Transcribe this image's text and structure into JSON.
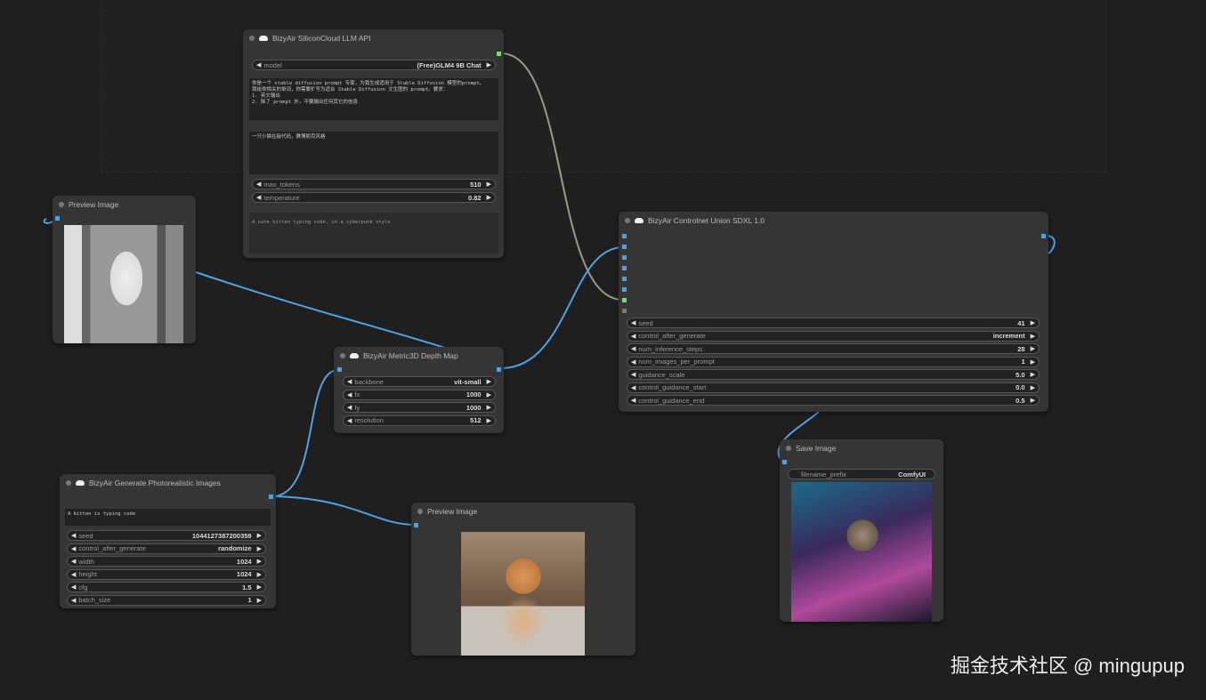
{
  "llm": {
    "title": "BizyAir SiliconCloud LLM API",
    "model_label": "model",
    "model_value": "(Free)GLM4 9B Chat",
    "system_prompt": "你是一个 stable diffusion prompt 专家，为我生成适用于 Stable Diffusion 模型的prompt。\n我给你相关的单词，你需要扩写为适合 Stable Diffusion 文生图的 prompt。要求：\n1. 英文输出\n2. 除了 prompt 外，不要输出任何其它的信息",
    "user_prompt": "一只小猫在敲代码，赛博朋克风格",
    "max_tokens_label": "max_tokens",
    "max_tokens": "510",
    "temperature_label": "temperature",
    "temperature": "0.82",
    "output": "A cute kitten typing code, in a cyberpunk style"
  },
  "preview1": {
    "title": "Preview Image"
  },
  "depth": {
    "title": "BizyAir Metric3D Depth Map",
    "widgets": [
      {
        "label": "backbone",
        "value": "vit-small"
      },
      {
        "label": "fx",
        "value": "1000"
      },
      {
        "label": "fy",
        "value": "1000"
      },
      {
        "label": "resolution",
        "value": "512"
      }
    ]
  },
  "gen": {
    "title": "BizyAir Generate Photorealistic Images",
    "prompt": "A kitten is typing code",
    "widgets": [
      {
        "label": "seed",
        "value": "1044127387200359"
      },
      {
        "label": "control_after_generate",
        "value": "randomize"
      },
      {
        "label": "width",
        "value": "1024"
      },
      {
        "label": "height",
        "value": "1024"
      },
      {
        "label": "cfg",
        "value": "1.5"
      },
      {
        "label": "batch_size",
        "value": "1"
      }
    ]
  },
  "preview2": {
    "title": "Preview Image"
  },
  "cn": {
    "title": "BizyAir Controlnet Union SDXL 1.0",
    "widgets": [
      {
        "label": "seed",
        "value": "41"
      },
      {
        "label": "control_after_generate",
        "value": "increment"
      },
      {
        "label": "num_inference_steps",
        "value": "28"
      },
      {
        "label": "num_images_per_prompt",
        "value": "1"
      },
      {
        "label": "guidance_scale",
        "value": "5.0"
      },
      {
        "label": "control_guidance_start",
        "value": "0.0"
      },
      {
        "label": "control_guidance_end",
        "value": "0.5"
      }
    ]
  },
  "save": {
    "title": "Save Image",
    "prefix_label": "filename_prefix",
    "prefix_value": "ComfyUI"
  },
  "watermark": "掘金技术社区 @ mingupup",
  "colors": {
    "wire_image": "#4da3e6",
    "wire_string": "#9a9a8a",
    "canvas": "#1f1f1f",
    "node": "#353535"
  }
}
